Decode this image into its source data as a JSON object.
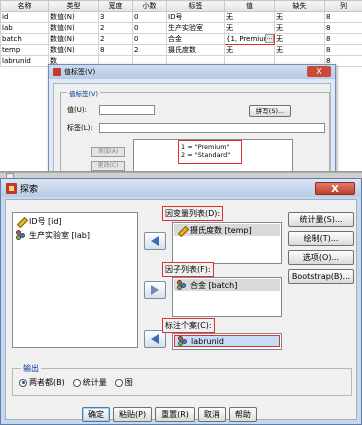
{
  "grid": {
    "headers": [
      "名称",
      "类型",
      "宽度",
      "小数",
      "标签",
      "值",
      "缺失",
      "列"
    ],
    "rows": [
      [
        "id",
        "数值(N)",
        "3",
        "0",
        "ID号",
        "无",
        "无",
        "8"
      ],
      [
        "lab",
        "数值(N)",
        "2",
        "0",
        "生产实验室",
        "无",
        "无",
        "8"
      ],
      [
        "batch",
        "数值(N)",
        "2",
        "0",
        "合金",
        "{1, Premium...",
        "无",
        "8"
      ],
      [
        "temp",
        "数值(N)",
        "8",
        "2",
        "摄氏度数",
        "无",
        "无",
        "8"
      ],
      [
        "labrunid",
        "数",
        "",
        "",
        "",
        "",
        "",
        "8"
      ]
    ]
  },
  "value_labels_dialog": {
    "title": "值标签(V)",
    "close": "X",
    "group_label": "值标签(V)",
    "value_label": "值(U):",
    "label_label": "标签(L):",
    "spell_button": "拼写(S)...",
    "add_button": "添加(A)",
    "change_button": "更改(C)",
    "list_items": [
      "1 = \"Premium\"",
      "2 = \"Standard\""
    ]
  },
  "explore_dialog": {
    "title": "探索",
    "close": "X",
    "source_vars": [
      {
        "label": "ID号 [id]",
        "icon": "scale-pencil-icon"
      },
      {
        "label": "生产实验室 [lab]",
        "icon": "nominal-icon"
      }
    ],
    "dependent_label": "因变量列表(D):",
    "dependent_items": [
      "摄氏度数 [temp]"
    ],
    "factor_label": "因子列表(F):",
    "factor_items": [
      "合金 [batch]"
    ],
    "case_label": "标注个案(C):",
    "case_items": [
      "labrunid"
    ],
    "side_buttons": [
      "统计量(S)...",
      "绘制(T)...",
      "选项(O)...",
      "Bootstrap(B)..."
    ],
    "output_label": "输出",
    "output_options": [
      {
        "label": "两者都(B)",
        "checked": true
      },
      {
        "label": "统计量",
        "checked": false
      },
      {
        "label": "图",
        "checked": false
      }
    ],
    "bottom_buttons": [
      "确定",
      "粘贴(P)",
      "重置(R)",
      "取消",
      "帮助"
    ]
  }
}
